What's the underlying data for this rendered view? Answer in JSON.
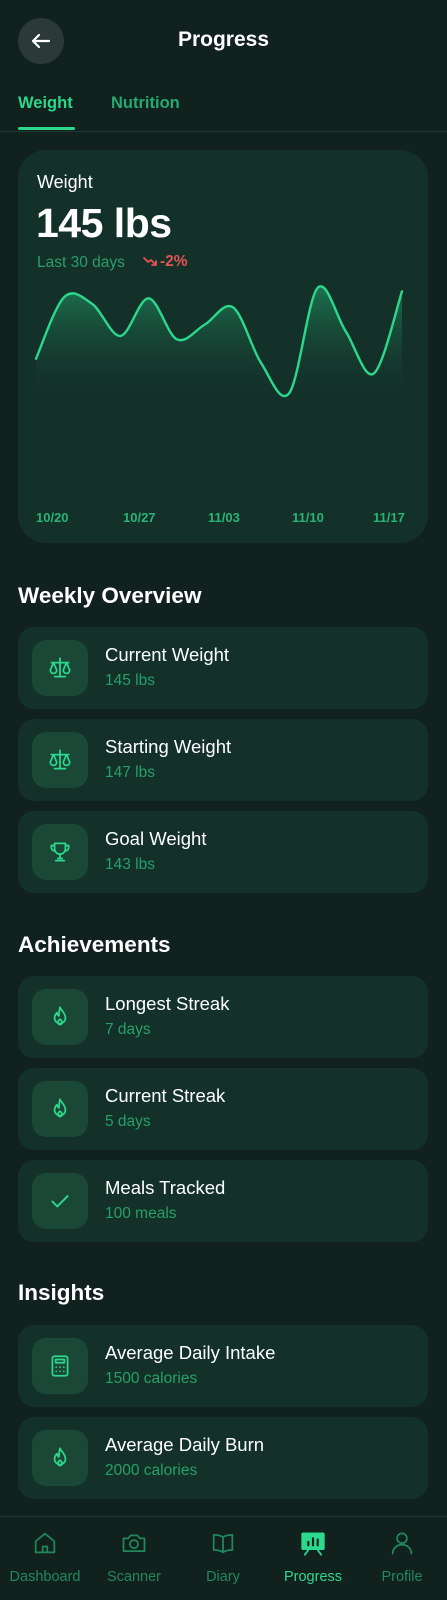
{
  "header": {
    "title": "Progress",
    "back_icon": "arrow-left-icon"
  },
  "tabs": [
    {
      "label": "Weight",
      "active": true
    },
    {
      "label": "Nutrition",
      "active": false
    }
  ],
  "weight_card": {
    "label": "Weight",
    "value": "145 lbs",
    "period": "Last 30 days",
    "trend": "-2%",
    "trend_icon": "trending-down-icon"
  },
  "chart_data": {
    "type": "area",
    "x_ticks": [
      "10/20",
      "10/27",
      "11/03",
      "11/10",
      "11/17"
    ],
    "values": [
      0.38,
      0.92,
      0.86,
      0.58,
      0.91,
      0.55,
      0.68,
      0.83,
      0.34,
      0.08,
      1.0,
      0.62,
      0.25,
      0.97
    ],
    "grid": false,
    "legend": "none"
  },
  "weekly_overview": {
    "title": "Weekly Overview",
    "items": [
      {
        "title": "Current Weight",
        "subtitle": "145 lbs",
        "icon": "scale-icon"
      },
      {
        "title": "Starting Weight",
        "subtitle": "147 lbs",
        "icon": "scale-icon"
      },
      {
        "title": "Goal Weight",
        "subtitle": "143 lbs",
        "icon": "trophy-icon"
      }
    ]
  },
  "achievements": {
    "title": "Achievements",
    "items": [
      {
        "title": "Longest Streak",
        "subtitle": "7 days",
        "icon": "flame-icon"
      },
      {
        "title": "Current Streak",
        "subtitle": "5 days",
        "icon": "flame-icon"
      },
      {
        "title": "Meals Tracked",
        "subtitle": "100 meals",
        "icon": "check-icon"
      }
    ]
  },
  "insights": {
    "title": "Insights",
    "items": [
      {
        "title": "Average Daily Intake",
        "subtitle": "1500 calories",
        "icon": "calculator-icon"
      },
      {
        "title": "Average Daily Burn",
        "subtitle": "2000 calories",
        "icon": "flame-icon"
      }
    ]
  },
  "bottom_nav": [
    {
      "label": "Dashboard",
      "icon": "home-icon",
      "active": false
    },
    {
      "label": "Scanner",
      "icon": "camera-icon",
      "active": false
    },
    {
      "label": "Diary",
      "icon": "book-icon",
      "active": false
    },
    {
      "label": "Progress",
      "icon": "chart-icon",
      "active": true
    },
    {
      "label": "Profile",
      "icon": "user-icon",
      "active": false
    }
  ],
  "colors": {
    "background": "#11211d",
    "card": "#133128",
    "accent": "#2bd88c",
    "accent_muted": "#26a06a",
    "negative": "#e45353"
  }
}
